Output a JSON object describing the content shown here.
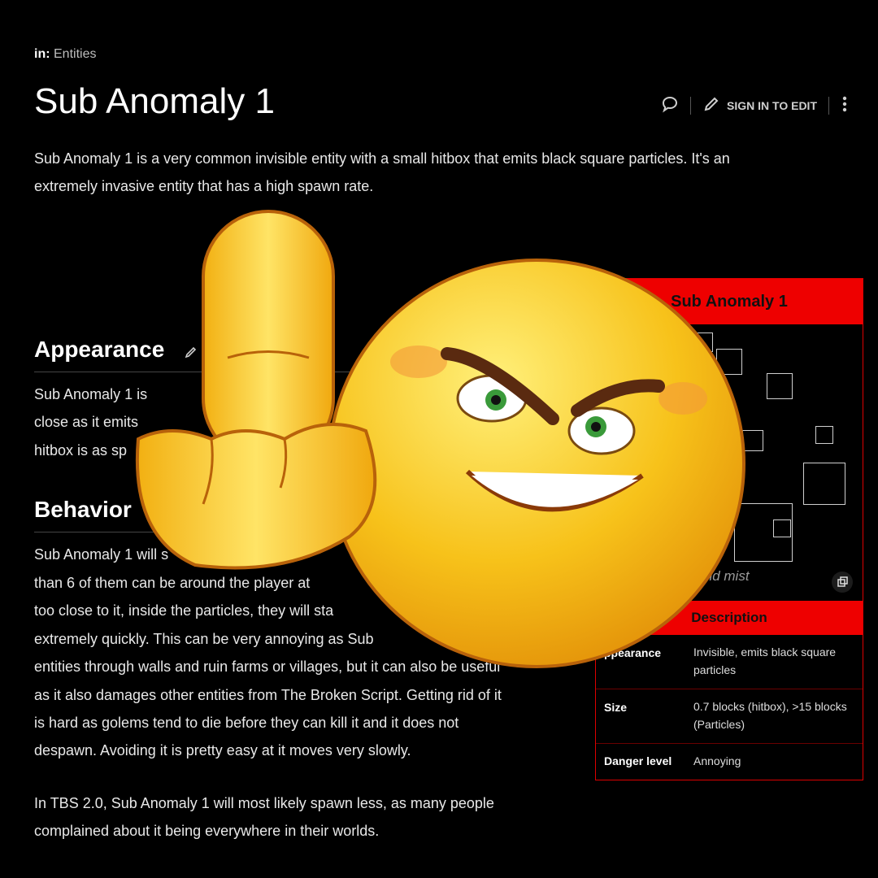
{
  "breadcrumb": {
    "prefix": "in:",
    "category": "Entities"
  },
  "page": {
    "title": "Sub Anomaly 1"
  },
  "toolbar": {
    "edit_label": "SIGN IN TO EDIT"
  },
  "content": {
    "intro": [
      "Sub Anomaly 1 is a very common invisible entity with a small hitbox that emits black square particles. It's an",
      "extremely invasive entity that has a high spawn rate."
    ],
    "appearance": {
      "heading": "Appearance",
      "lines": [
        "Sub Anomaly 1 is",
        "close as it emits",
        "hitbox is as sp"
      ]
    },
    "behavior": {
      "heading": "Behavior",
      "lines": [
        "Sub Anomaly 1 will s",
        "than 6 of them can be around the player at",
        "too close to it, inside the particles, they will sta",
        "extremely quickly. This can be very annoying as Sub",
        "entities through walls and ruin farms or villages, but it can also be useful",
        "as it also damages other entities from The Broken Script. Getting rid of it",
        "is hard as golems tend to die before they can kill it and it does not",
        "despawn. Avoiding it is pretty easy at it moves very slowly."
      ]
    },
    "tbs": [
      "In TBS 2.0, Sub Anomaly 1 will most likely spawn less, as many people",
      "complained about it being everywhere in their worlds."
    ]
  },
  "infobox": {
    "title": "Sub Anomaly 1",
    "caption": "id mist",
    "section": "Description",
    "rows": [
      {
        "key": "ppearance",
        "value": "Invisible, emits black square particles"
      },
      {
        "key": "Size",
        "value": "0.7 blocks (hitbox), >15 blocks (Particles)"
      },
      {
        "key": "Danger level",
        "value": "Annoying"
      }
    ]
  },
  "icons": [
    "comment-icon",
    "pencil-icon",
    "kebab-menu-icon",
    "expand-icon",
    "edit-section-icon"
  ],
  "colors": {
    "accent": "#e00000",
    "background": "#000000",
    "emoji": "#f7c21a"
  }
}
